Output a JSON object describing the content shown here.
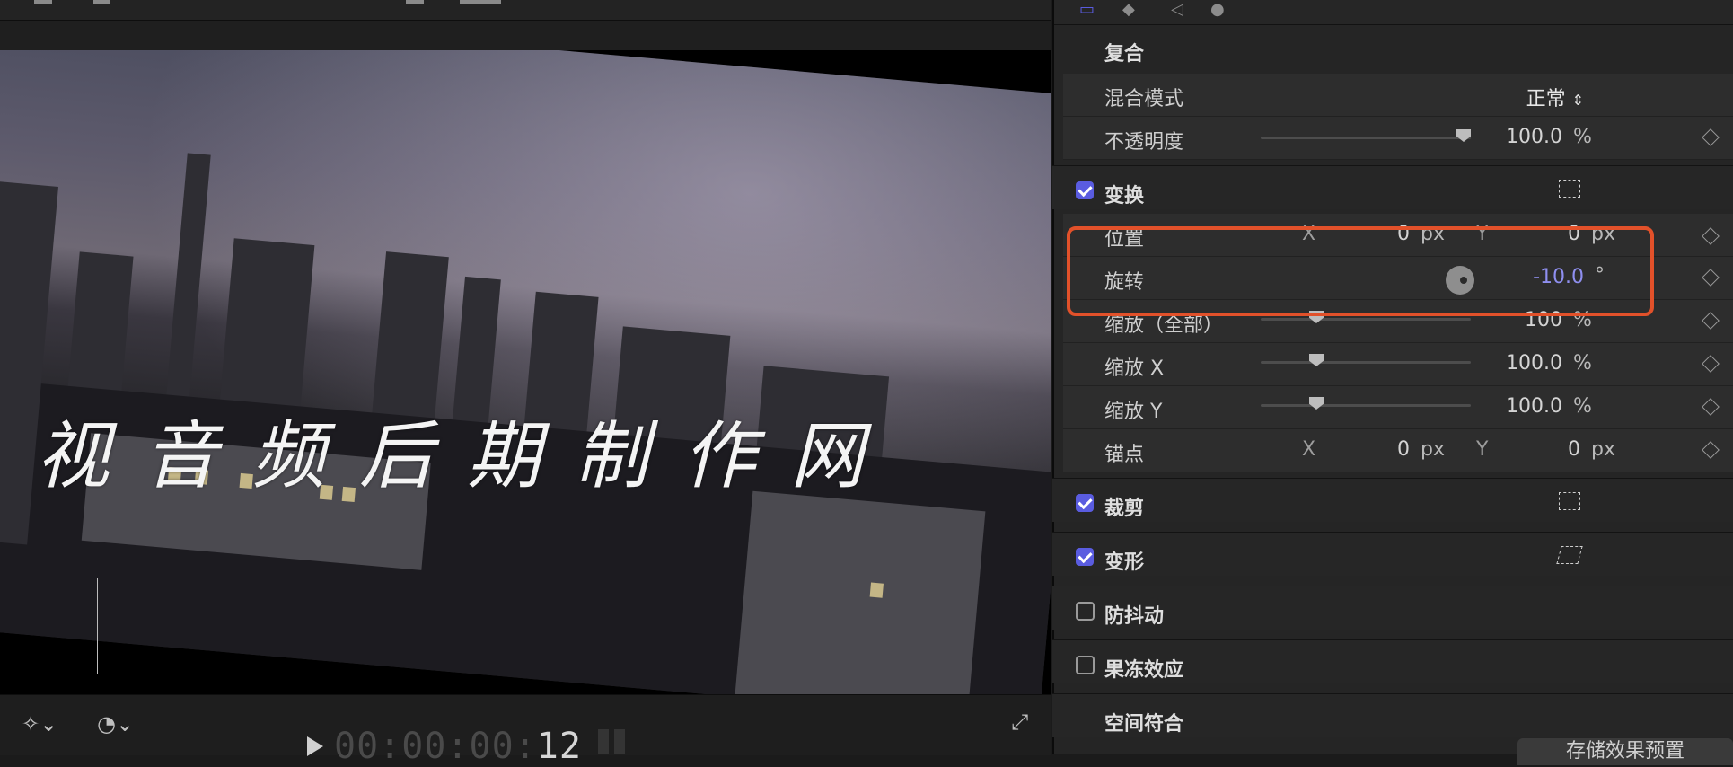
{
  "inspector": {
    "compositing": {
      "title": "复合",
      "blend_mode": {
        "label": "混合模式",
        "value": "正常"
      },
      "opacity": {
        "label": "不透明度",
        "value": "100.0",
        "unit": "%",
        "slider_level": 1.0
      }
    },
    "transform": {
      "title": "变换",
      "enabled": true,
      "position": {
        "label": "位置",
        "x_axis": "X",
        "x_value": "0",
        "x_unit": "px",
        "y_axis": "Y",
        "y_value": "0",
        "y_unit": "px"
      },
      "rotation": {
        "label": "旋转",
        "value": "-10.0",
        "unit": "°"
      },
      "scale_all": {
        "label": "缩放（全部）",
        "value": "100",
        "unit": "%",
        "slider_level": 0.27
      },
      "scale_x": {
        "label": "缩放 X",
        "value": "100.0",
        "unit": "%",
        "slider_level": 0.27
      },
      "scale_y": {
        "label": "缩放 Y",
        "value": "100.0",
        "unit": "%",
        "slider_level": 0.27
      },
      "anchor": {
        "label": "锚点",
        "x_axis": "X",
        "x_value": "0",
        "x_unit": "px",
        "y_axis": "Y",
        "y_value": "0",
        "y_unit": "px"
      }
    },
    "crop": {
      "title": "裁剪",
      "enabled": true
    },
    "distort": {
      "title": "变形",
      "enabled": true
    },
    "stabilization": {
      "title": "防抖动",
      "enabled": false
    },
    "rolling_shutter": {
      "title": "果冻效应",
      "enabled": false
    },
    "spatial_conform": {
      "title": "空间符合"
    },
    "save_preset_label": "存储效果预置",
    "highlight_color": "#e2512a",
    "accent_color": "#5a5ce0",
    "rotation_value_color": "#8f8ff0"
  },
  "viewer": {
    "watermark_text": "视音频后期制作网",
    "timecode_dim": "00:00:00:",
    "timecode_lit": "12",
    "icons": [
      "magic-wand-icon",
      "speed-gauge-icon",
      "play-icon",
      "fullscreen-icon"
    ]
  }
}
